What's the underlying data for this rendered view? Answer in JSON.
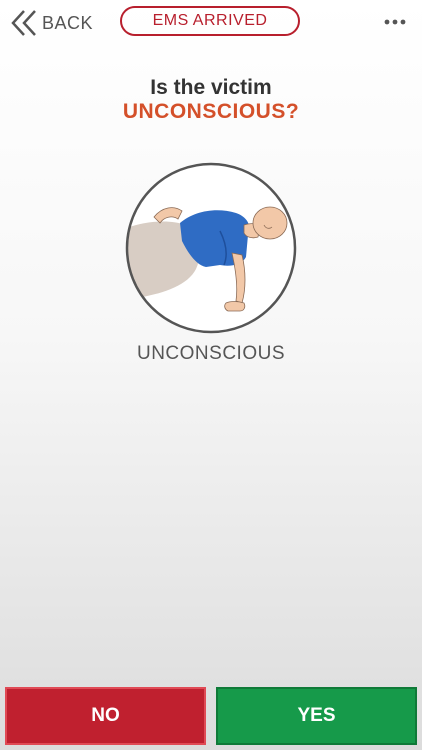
{
  "header": {
    "back_label": "BACK",
    "ems_label": "EMS ARRIVED",
    "more_icon": "more-dots-icon"
  },
  "prompt": {
    "line1": "Is the victim",
    "line2": "UNCONSCIOUS?"
  },
  "illustration": {
    "caption": "UNCONSCIOUS",
    "icon": "unconscious-victim-icon"
  },
  "actions": {
    "no_label": "NO",
    "yes_label": "YES"
  },
  "colors": {
    "accent_red": "#b81f2d",
    "question_orange": "#d4502a",
    "no_button": "#c0202f",
    "yes_button": "#169a4a"
  }
}
